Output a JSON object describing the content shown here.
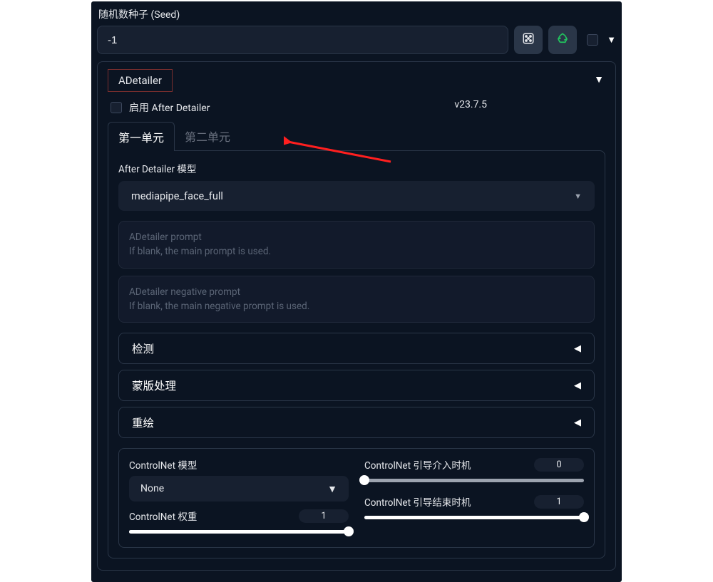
{
  "seed": {
    "label": "随机数种子 (Seed)",
    "value": "-1"
  },
  "adetailer": {
    "title": "ADetailer",
    "enable_label": "启用 After Detailer",
    "version": "v23.7.5",
    "tabs": {
      "first": "第一单元",
      "second": "第二单元"
    },
    "model": {
      "label": "After Detailer 模型",
      "selected": "mediapipe_face_full"
    },
    "prompt": {
      "placeholder_line1": "ADetailer prompt",
      "placeholder_line2": "If blank, the main prompt is used."
    },
    "neg_prompt": {
      "placeholder_line1": "ADetailer negative prompt",
      "placeholder_line2": "If blank, the main negative prompt is used."
    },
    "accordions": {
      "detect": "检测",
      "mask": "蒙版处理",
      "inpaint": "重绘"
    },
    "controlnet": {
      "model_label": "ControlNet 模型",
      "model_selected": "None",
      "weight_label": "ControlNet 权重",
      "weight_value": "1",
      "start_label": "ControlNet 引导介入时机",
      "start_value": "0",
      "end_label": "ControlNet 引导结束时机",
      "end_value": "1"
    }
  }
}
